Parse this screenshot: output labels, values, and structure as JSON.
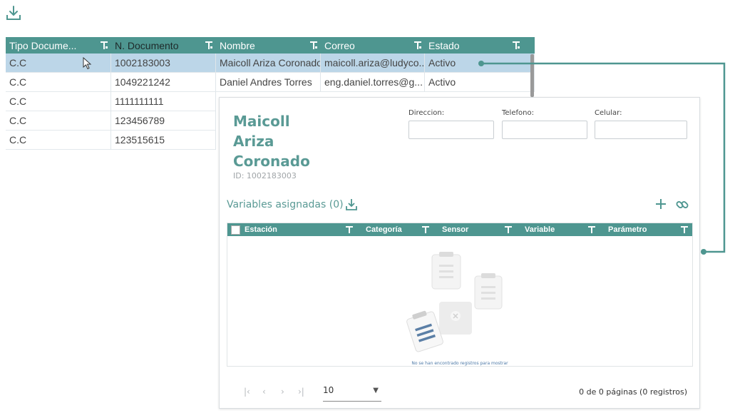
{
  "toolbar": {
    "download_icon": "download-icon"
  },
  "table": {
    "columns": [
      "Tipo Docume...",
      "N. Documento",
      "Nombre",
      "Correo",
      "Estado"
    ],
    "rows": [
      [
        "C.C",
        "1002183003",
        "Maicoll Ariza Coronado",
        "maicoll.ariza@ludyco...",
        "Activo"
      ],
      [
        "C.C",
        "1049221242",
        "Daniel Andres Torres",
        "eng.daniel.torres@g...",
        "Activo"
      ],
      [
        "C.C",
        "1111111111",
        "",
        "",
        ""
      ],
      [
        "C.C",
        "123456789",
        "",
        "",
        ""
      ],
      [
        "C.C",
        "123515615",
        "",
        "",
        ""
      ]
    ],
    "selected_row": 0
  },
  "detail": {
    "name": "Maicoll Ariza Coronado",
    "id_label": "ID: 1002183003",
    "fields": {
      "direccion": "Direccion:",
      "telefono": "Telefono:",
      "celular": "Celular:"
    },
    "variables_title": "Variables asignadas (0)",
    "subtable_columns": [
      "Estación",
      "Categoría",
      "Sensor",
      "Variable",
      "Parámetro"
    ],
    "empty_message": "No se han encontrado registros para mostrar",
    "pager": {
      "page_size": "10",
      "info": "0 de 0 páginas (0 registros)"
    }
  },
  "colors": {
    "header": "#4e9690",
    "accent": "#5a9a95",
    "selected": "#bcd6e8"
  }
}
